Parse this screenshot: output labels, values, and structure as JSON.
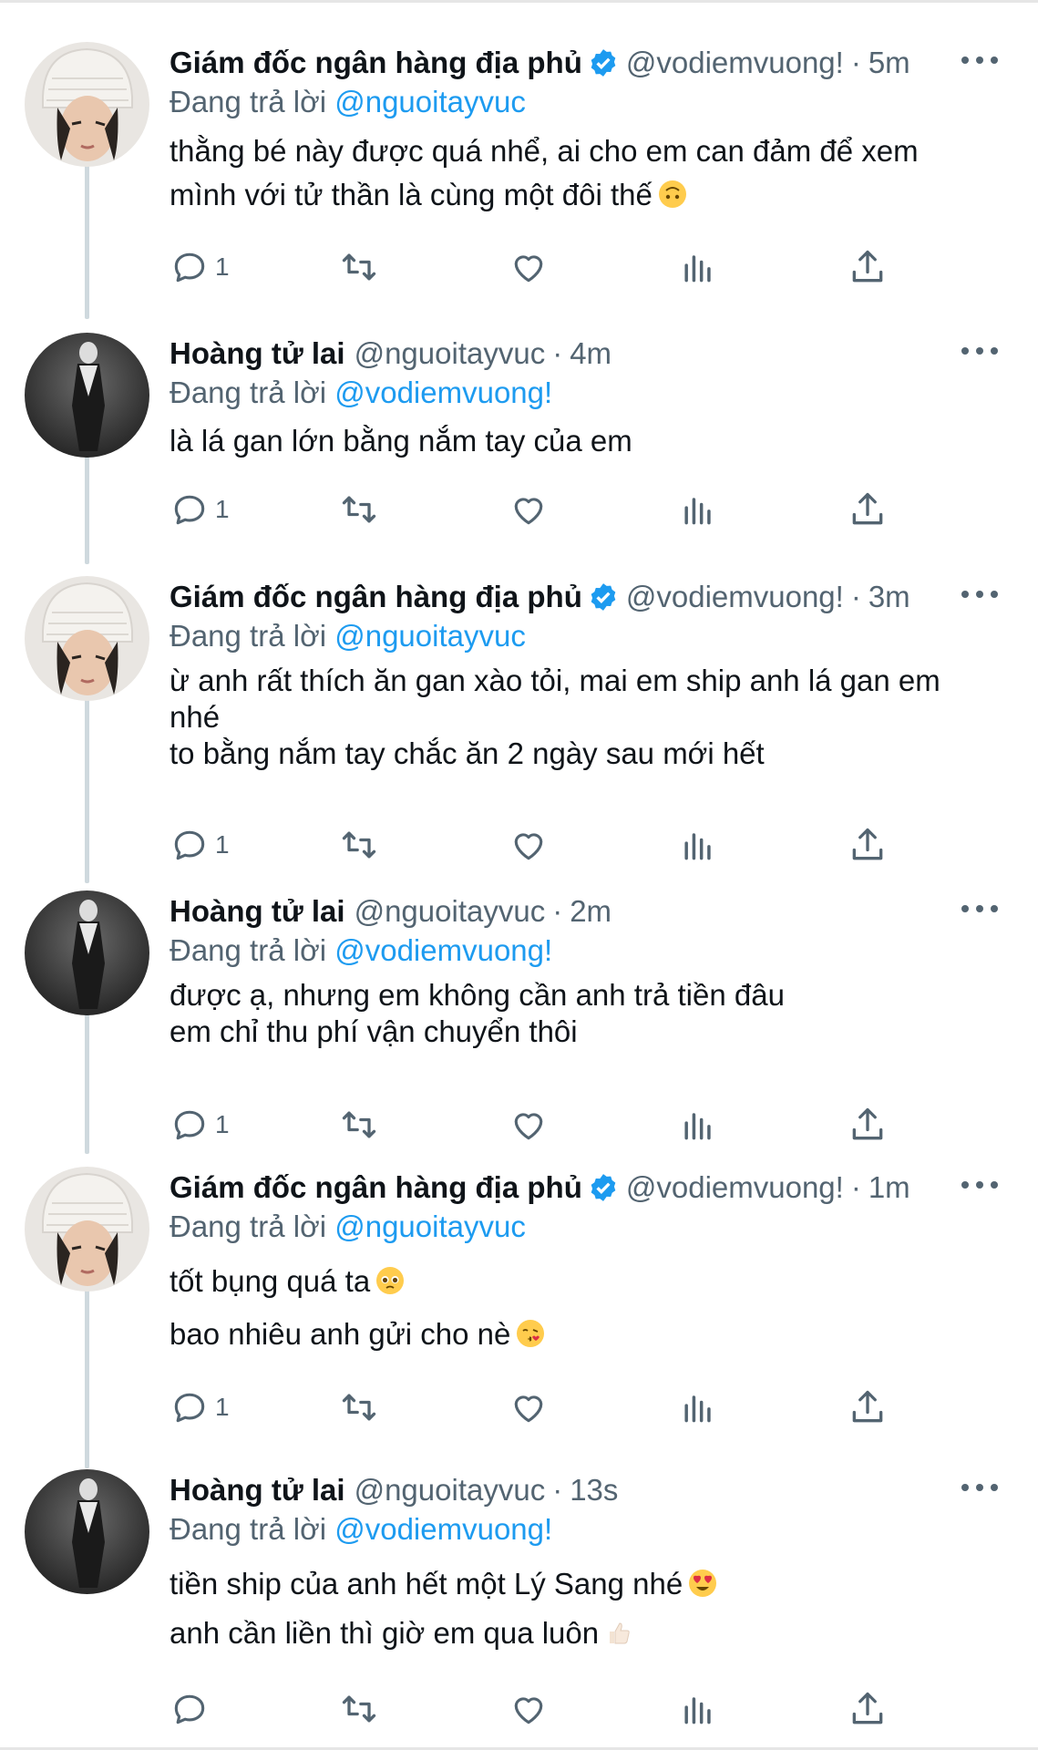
{
  "colors": {
    "link": "#1d9bf0",
    "muted": "#536471",
    "text": "#0f1419",
    "thread_line": "#cfd9de"
  },
  "icons": {
    "verified": "verified-badge-icon",
    "reply": "reply-icon",
    "retweet": "retweet-icon",
    "like": "heart-icon",
    "views": "views-icon",
    "share": "share-icon",
    "more": "more-icon"
  },
  "tweets": [
    {
      "name": "Giám đốc ngân hàng địa phủ",
      "verified": true,
      "handle": "@vodiemvuong!",
      "sep": "·",
      "time": "5m",
      "reply_label": "Đang trả lời",
      "reply_to": "@nguoitayvuc",
      "lines": [
        "thằng bé này được quá nhể, ai cho em can đảm để xem",
        "mình với tử thần là cùng một đôi thế"
      ],
      "emoji": "upside-down-face-emoji",
      "reply_count": "1"
    },
    {
      "name": "Hoàng tử lai",
      "verified": false,
      "handle": "@nguoitayvuc",
      "sep": "·",
      "time": "4m",
      "reply_label": "Đang trả lời",
      "reply_to": "@vodiemvuong!",
      "lines": [
        "là lá gan lớn bằng nắm tay của em"
      ],
      "reply_count": "1"
    },
    {
      "name": "Giám đốc ngân hàng địa phủ",
      "verified": true,
      "handle": "@vodiemvuong!",
      "sep": "·",
      "time": "3m",
      "reply_label": "Đang trả lời",
      "reply_to": "@nguoitayvuc",
      "lines": [
        "ừ anh rất thích ăn gan xào tỏi, mai em ship anh lá gan em",
        "nhé",
        "to bằng nắm tay chắc ăn 2 ngày sau mới hết"
      ],
      "reply_count": "1"
    },
    {
      "name": "Hoàng tử lai",
      "verified": false,
      "handle": "@nguoitayvuc",
      "sep": "·",
      "time": "2m",
      "reply_label": "Đang trả lời",
      "reply_to": "@vodiemvuong!",
      "lines": [
        "được ạ, nhưng em không cần anh trả tiền đâu",
        "em chỉ thu phí vận chuyển thôi"
      ],
      "reply_count": "1"
    },
    {
      "name": "Giám đốc ngân hàng địa phủ",
      "verified": true,
      "handle": "@vodiemvuong!",
      "sep": "·",
      "time": "1m",
      "reply_label": "Đang trả lời",
      "reply_to": "@nguoitayvuc",
      "lines": [
        "tốt bụng quá ta",
        "bao nhiêu anh gửi cho nè"
      ],
      "line_emojis": [
        "pleading-face-emoji",
        "kissing-face-emoji"
      ],
      "reply_count": "1"
    },
    {
      "name": "Hoàng tử lai",
      "verified": false,
      "handle": "@nguoitayvuc",
      "sep": "·",
      "time": "13s",
      "reply_label": "Đang trả lời",
      "reply_to": "@vodiemvuong!",
      "lines": [
        "tiền ship của anh hết một Lý Sang nhé",
        "anh cần liền thì giờ em qua luôn"
      ],
      "line_emojis": [
        "heart-eyes-emoji",
        "thumbs-up-emoji"
      ],
      "reply_count": ""
    }
  ]
}
